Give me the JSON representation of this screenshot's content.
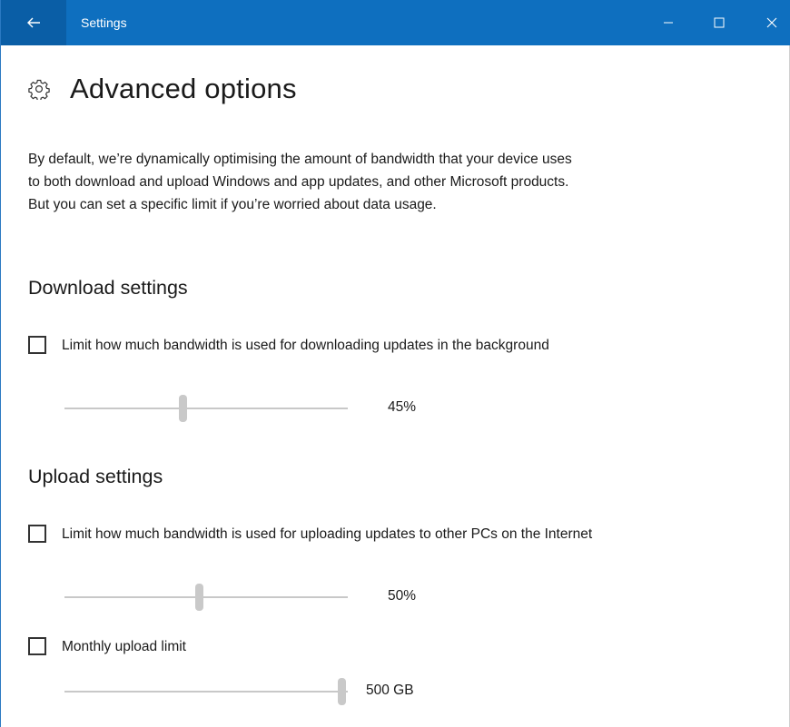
{
  "window": {
    "title": "Settings"
  },
  "page": {
    "title": "Advanced options",
    "description": "By default, we’re dynamically optimising the amount of bandwidth that your device uses to both download and upload Windows and app updates, and other Microsoft products. But you can set a specific limit if you’re worried about data usage."
  },
  "download": {
    "section_title": "Download settings",
    "limit_label": "Limit how much bandwidth is used for downloading updates in the background",
    "limit_checked": false,
    "slider_value_label": "45%",
    "slider_fraction": 0.45
  },
  "upload": {
    "section_title": "Upload settings",
    "limit_label": "Limit how much bandwidth is used for uploading updates to other PCs on the Internet",
    "limit_checked": false,
    "slider_value_label": "50%",
    "slider_fraction": 0.5,
    "monthly_label": "Monthly upload limit",
    "monthly_checked": false,
    "monthly_value_label": "500 GB",
    "monthly_fraction": 1.0
  },
  "icons": {
    "back": "back-arrow-icon",
    "minimize": "minimize-icon",
    "maximize": "maximize-icon",
    "close": "close-icon",
    "heading": "gear-icon"
  },
  "colors": {
    "titlebar": "#0e6fbf",
    "back_button": "#0a5ea6",
    "slider_thumb": "#c9c9c9",
    "slider_track": "#c8c8c8"
  }
}
